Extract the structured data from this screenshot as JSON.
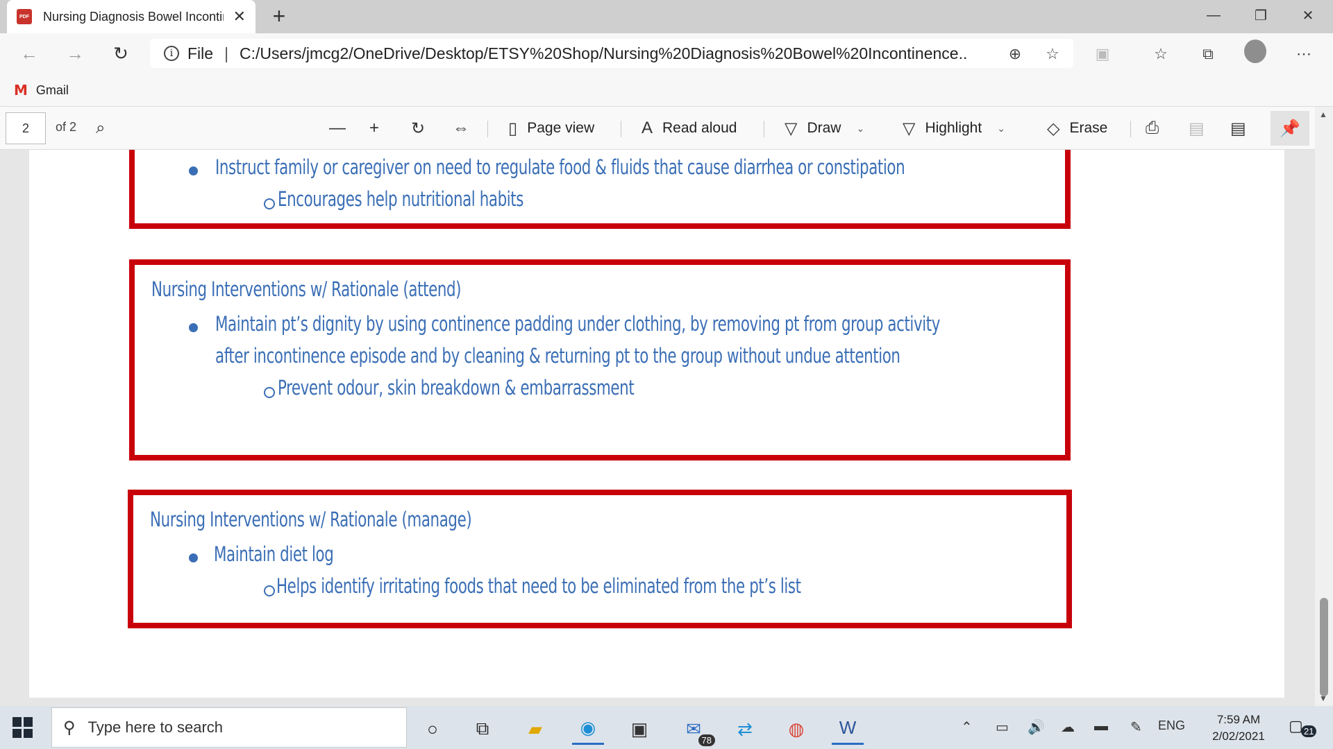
{
  "browser": {
    "tab_title": "Nursing Diagnosis Bowel Incontinence",
    "tab_icon_text": "PDF",
    "new_tab": "+",
    "address_scheme": "File",
    "address_url": "C:/Users/jmcg2/OneDrive/Desktop/ETSY%20Shop/Nursing%20Diagnosis%20Bowel%20Incontinence...",
    "favorites": [
      {
        "label": "Gmail",
        "icon": "gmail-icon"
      }
    ]
  },
  "pdf_toolbar": {
    "page_current": "2",
    "page_total": "of 2",
    "page_view": "Page view",
    "read_aloud": "Read aloud",
    "draw": "Draw",
    "highlight": "Highlight",
    "erase": "Erase"
  },
  "document": {
    "card1": {
      "bullet": "Instruct family or caregiver on need to regulate food & fluids that cause diarrhea or constipation",
      "sub": "Encourages help nutritional habits"
    },
    "card2": {
      "heading": "Nursing Interventions w/ Rationale (attend)",
      "bullet_line1": "Maintain pt’s dignity by using continence padding under clothing, by removing pt from group activity",
      "bullet_line2": "after incontinence episode and by cleaning & returning pt to the group without undue attention",
      "sub": "Prevent odour, skin breakdown & embarrassment"
    },
    "card3": {
      "heading": "Nursing Interventions w/ Rationale (manage)",
      "bullet": "Maintain diet log",
      "sub": "Helps identify irritating foods that need to be eliminated from the pt’s list"
    },
    "border_color": "#c8000a",
    "text_color": "#3a6eb5"
  },
  "taskbar": {
    "search_placeholder": "Type here to search",
    "mail_badge": "78",
    "language": "ENG",
    "time": "7:59 AM",
    "date": "2/02/2021",
    "notification_count": "21"
  }
}
